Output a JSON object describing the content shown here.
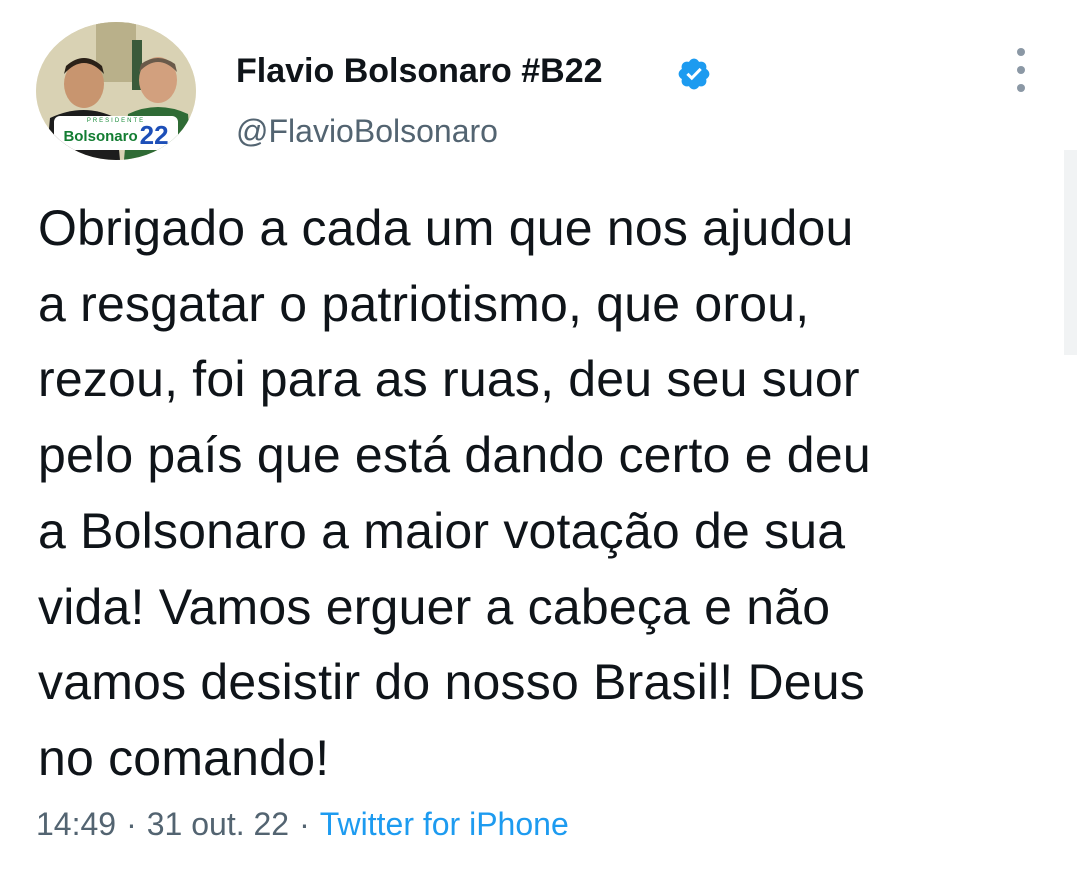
{
  "author": {
    "display_name": "Flavio Bolsonaro #B22",
    "handle": "@FlavioBolsonaro",
    "verified": true,
    "avatar_badge_text": "Bolsonaro",
    "avatar_badge_number": "22",
    "avatar_badge_small": "PRESIDENTE"
  },
  "tweet": {
    "text": "Obrigado a cada um que nos ajudou\na resgatar o patriotismo, que orou,\nrezou, foi para as ruas, deu seu suor\npelo país que está dando certo e deu\na Bolsonaro a maior votação de sua\nvida! Vamos erguer a cabeça e não\nvamos desistir do nosso Brasil! Deus\nno comando!",
    "time": "14:49",
    "date": "31 out. 22",
    "separator": "·",
    "source": "Twitter for iPhone"
  },
  "icons": {
    "verified": "verified-badge-icon",
    "more": "more-options-icon"
  },
  "colors": {
    "verified_blue": "#1d9bf0",
    "link_blue": "#1d9bf0",
    "secondary_text": "#536471",
    "primary_text": "#0f1419"
  }
}
